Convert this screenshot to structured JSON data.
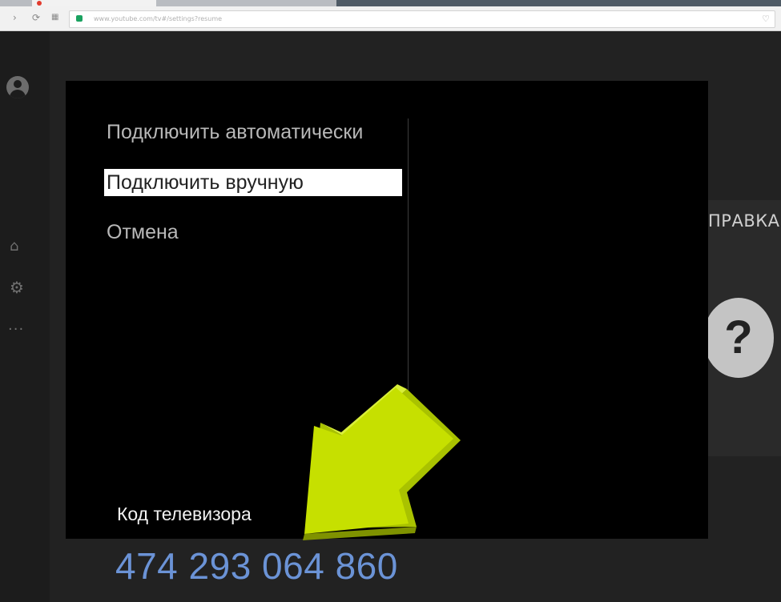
{
  "browser": {
    "url": "www.youtube.com/tv#/settings?resume",
    "back_icon": "chevron-right-icon",
    "reload_icon": "reload-icon",
    "grid_icon": "grid-icon",
    "lock_icon": "lock-icon",
    "bookmark_icon": "heart-icon"
  },
  "rail": {
    "icons": [
      "account-icon",
      "home-icon",
      "gear-icon",
      "more-icon"
    ],
    "more_glyph": "···"
  },
  "dialog": {
    "menu": [
      {
        "label": "Подключить автоматически",
        "selected": false
      },
      {
        "label": "Подключить вручную",
        "selected": true
      },
      {
        "label": "Отмена",
        "selected": false
      }
    ],
    "code_label": "Код телевизора",
    "tv_code": "474 293 064 860"
  },
  "side_panel": {
    "help_label": "ПРАВКА",
    "help_glyph": "?"
  },
  "colors": {
    "background": "#222222",
    "dialog": "#000000",
    "code": "#6b93d6",
    "arrow": "#c6e000"
  }
}
